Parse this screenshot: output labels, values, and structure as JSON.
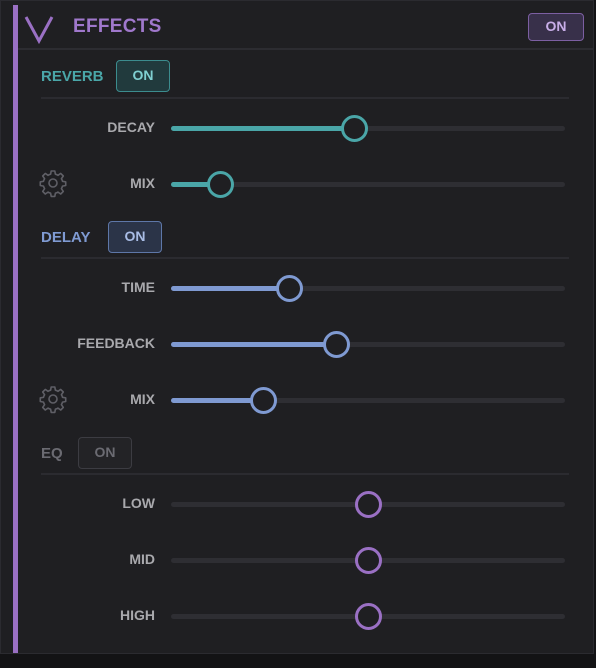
{
  "header": {
    "title": "EFFECTS",
    "master_toggle": "ON",
    "accent_color": "#9a70c4"
  },
  "sections": [
    {
      "title": "REVERB",
      "toggle": "ON",
      "enabled": true,
      "color": "#4aa6a8",
      "has_settings": true,
      "params": [
        {
          "label": "DECAY",
          "value": 0.465
        },
        {
          "label": "MIX",
          "value": 0.125
        }
      ]
    },
    {
      "title": "DELAY",
      "toggle": "ON",
      "enabled": true,
      "color": "#7f9ad2",
      "has_settings": true,
      "params": [
        {
          "label": "TIME",
          "value": 0.3
        },
        {
          "label": "FEEDBACK",
          "value": 0.42
        },
        {
          "label": "MIX",
          "value": 0.235
        }
      ]
    },
    {
      "title": "EQ",
      "toggle": "ON",
      "enabled": false,
      "color": "#9a70c4",
      "has_settings": false,
      "params": [
        {
          "label": "LOW",
          "value": 0.5
        },
        {
          "label": "MID",
          "value": 0.5
        },
        {
          "label": "HIGH",
          "value": 0.5
        }
      ]
    }
  ],
  "icons": {
    "collapse": "chevron-down-icon",
    "settings": "gear-icon"
  }
}
